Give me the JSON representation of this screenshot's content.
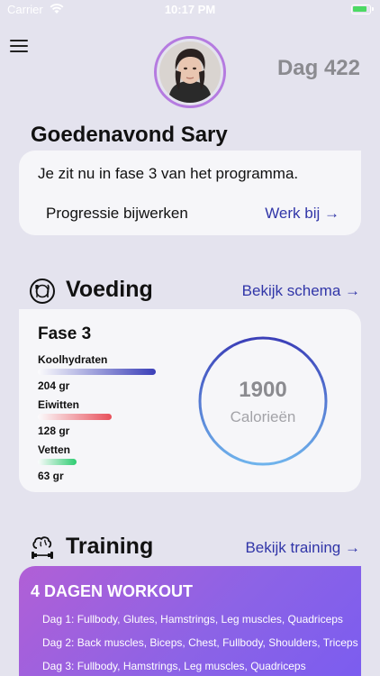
{
  "status_bar": {
    "carrier": "Carrier",
    "time": "10:17 PM"
  },
  "header": {
    "day_label": "Dag 422",
    "greeting": "Goedenavond Sary"
  },
  "phase_card": {
    "text": "Je zit nu in fase 3 van het programma.",
    "update_label": "Progressie bijwerken",
    "update_link": "Werk bij →"
  },
  "nutrition": {
    "title": "Voeding",
    "link": "Bekijk schema →",
    "phase_title": "Fase 3",
    "macros": [
      {
        "name": "Koolhydraten",
        "value": "204 gr",
        "color": "#3b3fb8",
        "level": 0.77
      },
      {
        "name": "Eiwitten",
        "value": "128 gr",
        "color": "#e8505b",
        "level": 0.48
      },
      {
        "name": "Vetten",
        "value": "63 gr",
        "color": "#2ecc71",
        "level": 0.25
      }
    ],
    "calories_value": "1900",
    "calories_label": "Calorieën"
  },
  "training": {
    "title": "Training",
    "link": "Bekijk training →",
    "workout_title": "4 DAGEN WORKOUT",
    "days": [
      "Dag 1: Fullbody, Glutes, Hamstrings, Leg muscles, Quadriceps",
      "Dag 2: Back muscles, Biceps, Chest, Fullbody, Shoulders, Triceps",
      "Dag 3: Fullbody, Hamstrings, Leg muscles, Quadriceps"
    ]
  },
  "colors": {
    "accent": "#3136a8",
    "background": "#e4e3ee",
    "card": "#f6f6f9"
  }
}
